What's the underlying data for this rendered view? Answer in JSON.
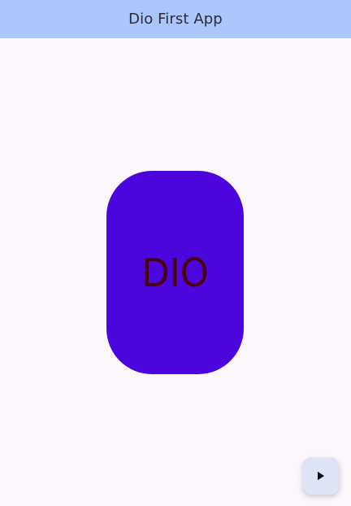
{
  "app_bar": {
    "title": "Dio First App",
    "background": "#abc6fa"
  },
  "main": {
    "card_text": "DIO",
    "card_color": "#4a06dc",
    "text_color": "#48000c",
    "background": "#fcf7fb"
  },
  "fab": {
    "icon": "play-icon",
    "background": "#dfe4f5"
  }
}
